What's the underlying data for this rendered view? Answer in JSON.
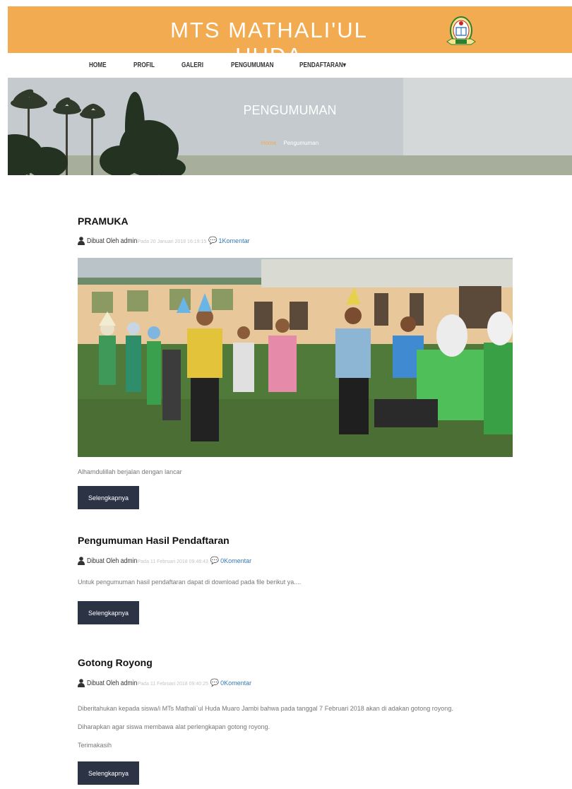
{
  "site": {
    "title": "MTS MATHALI'UL HUDA"
  },
  "nav": {
    "items": [
      "HOME",
      "PROFIL",
      "GALERI",
      "PENGUMUMAN",
      "PENDAFTARAN"
    ]
  },
  "banner": {
    "title": "PENGUMUMAN",
    "breadcrumb_home": "Home",
    "breadcrumb_current": "Pengumuman"
  },
  "posts": [
    {
      "title": "PRAMUKA",
      "author": "Dibuat Oleh admin",
      "date": "Pada 20 Januari 2018 16:19:15",
      "comments": "1Komentar",
      "paragraphs": [
        "Alhamdulillah berjalan dengan lancar"
      ],
      "button": "Selengkapnya"
    },
    {
      "title": "Pengumuman Hasil Pendaftaran",
      "author": "Dibuat Oleh admin",
      "date": "Pada 11 Februari 2018 09:48:43",
      "comments": "0Komentar",
      "paragraphs": [
        "Untuk pengumuman hasil pendaftaran dapat di download pada file berikut ya...."
      ],
      "button": "Selengkapnya"
    },
    {
      "title": "Gotong Royong",
      "author": "Dibuat Oleh admin",
      "date": "Pada 11 Februari 2018 09:40:25",
      "comments": "0Komentar",
      "paragraphs": [
        "Diberitahukan kepada siswa/i MTs Mathali`ul Huda Muaro Jambi bahwa pada tanggal 7 Februari 2018 akan di adakan gotong royong.",
        "Diharapkan agar siswa membawa alat perlengkapan gotong royong.",
        "Terimakasih"
      ],
      "button": "Selengkapnya"
    }
  ],
  "colors": {
    "header": "#F2AB50",
    "button": "#2B3345",
    "link": "#337ab7"
  }
}
